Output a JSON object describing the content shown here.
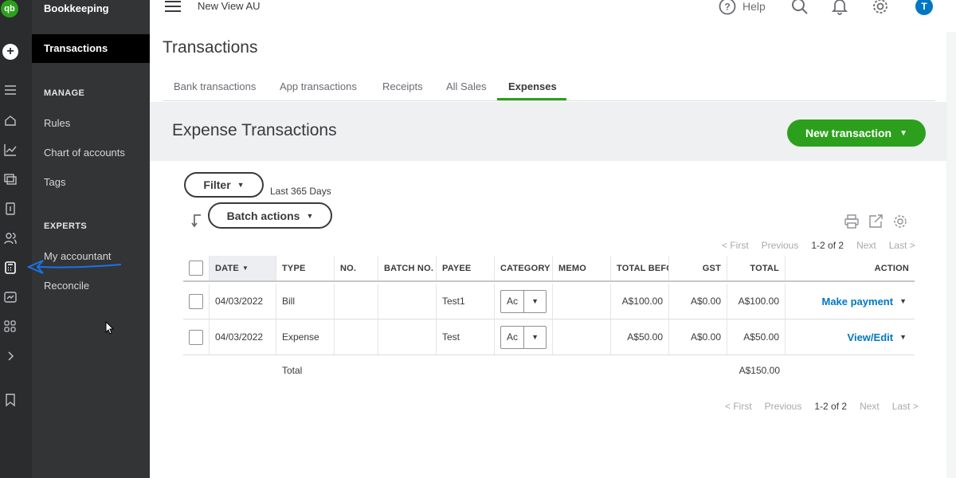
{
  "rail": {
    "logo_text": "qb",
    "avatar_initial": "T"
  },
  "sidebar": {
    "title": "Bookkeeping",
    "active_item": "Transactions",
    "sections": [
      {
        "label": "MANAGE",
        "items": [
          "Rules",
          "Chart of accounts",
          "Tags"
        ]
      },
      {
        "label": "EXPERTS",
        "items": [
          "My accountant",
          "Reconcile"
        ]
      }
    ]
  },
  "topbar": {
    "company": "New View AU",
    "help_label": "Help"
  },
  "page": {
    "title": "Transactions",
    "tabs": [
      "Bank transactions",
      "App transactions",
      "Receipts",
      "All Sales",
      "Expenses"
    ],
    "active_tab": "Expenses"
  },
  "expenses": {
    "title": "Expense Transactions",
    "new_button": "New transaction",
    "filter_button": "Filter",
    "filter_desc": "Last 365 Days",
    "batch_button": "Batch actions",
    "pager": {
      "first": "< First",
      "previous": "Previous",
      "range": "1-2 of 2",
      "next": "Next",
      "last": "Last >"
    }
  },
  "table": {
    "columns": [
      "DATE",
      "TYPE",
      "NO.",
      "BATCH NO.",
      "PAYEE",
      "CATEGORY",
      "MEMO",
      "TOTAL BEFC",
      "GST",
      "TOTAL",
      "ACTION"
    ],
    "rows": [
      {
        "date": "04/03/2022",
        "type": "Bill",
        "no": "",
        "batch": "",
        "payee": "Test1",
        "category": "Ac",
        "memo": "",
        "total_before": "A$100.00",
        "gst": "A$0.00",
        "total": "A$100.00",
        "action": "Make payment"
      },
      {
        "date": "04/03/2022",
        "type": "Expense",
        "no": "",
        "batch": "",
        "payee": "Test",
        "category": "Ac",
        "memo": "",
        "total_before": "A$50.00",
        "gst": "A$0.00",
        "total": "A$50.00",
        "action": "View/Edit"
      }
    ],
    "total_label": "Total",
    "total_value": "A$150.00"
  },
  "colors": {
    "brand_green": "#2ca01c",
    "link_blue": "#0077c5",
    "rail_bg": "#2b2c2e",
    "panel_bg": "#333436",
    "annotation_arrow": "#1a73e8"
  }
}
